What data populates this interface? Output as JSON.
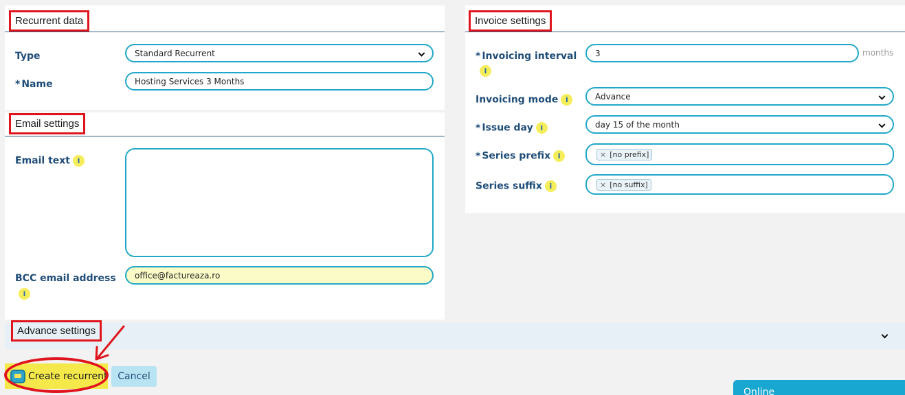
{
  "recurrent": {
    "title": "Recurrent data",
    "type_label": "Type",
    "type_value": "Standard Recurrent",
    "name_label": "Name",
    "name_value": "Hosting Services 3 Months"
  },
  "email": {
    "title": "Email settings",
    "text_label": "Email text",
    "text_value": "",
    "bcc_label": "BCC email address",
    "bcc_value": "office@factureaza.ro"
  },
  "invoice": {
    "title": "Invoice settings",
    "interval_label": "Invoicing interval",
    "interval_value": "3",
    "interval_unit": "months",
    "mode_label": "Invoicing mode",
    "mode_value": "Advance",
    "issue_label": "Issue day",
    "issue_value": "day 15 of the month",
    "prefix_label": "Series prefix",
    "prefix_tag": "[no prefix]",
    "suffix_label": "Series suffix",
    "suffix_tag": "[no suffix]"
  },
  "advance": {
    "title": "Advance settings"
  },
  "actions": {
    "create_label": "Create recurrent",
    "cancel_label": "Cancel"
  },
  "chat": {
    "label": "Online"
  },
  "common": {
    "required_mark": "*",
    "info_glyph": "i",
    "remove_glyph": "×"
  },
  "colors": {
    "accent_border": "#21a8c9",
    "highlight_red": "#e0141c",
    "button_yellow": "#f4e84a",
    "info_yellow": "#f5ee5a"
  }
}
